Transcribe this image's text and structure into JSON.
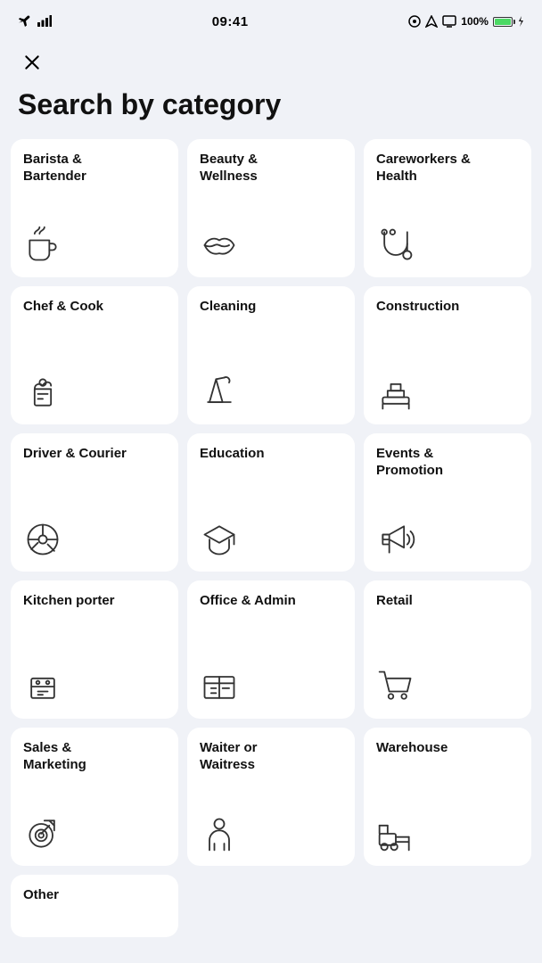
{
  "statusBar": {
    "time": "09:41",
    "battery": "100%",
    "signal": "●●●"
  },
  "closeLabel": "×",
  "pageTitle": "Search by category",
  "categories": [
    {
      "id": "barista-bartender",
      "label": "Barista &\nBartender",
      "icon": "coffee"
    },
    {
      "id": "beauty-wellness",
      "label": "Beauty &\nWellness",
      "icon": "lips"
    },
    {
      "id": "careworkers-health",
      "label": "Careworkers &\nHealth",
      "icon": "stethoscope"
    },
    {
      "id": "chef-cook",
      "label": "Chef & Cook",
      "icon": "chef"
    },
    {
      "id": "cleaning",
      "label": "Cleaning",
      "icon": "cleaning"
    },
    {
      "id": "construction",
      "label": "Construction",
      "icon": "construction"
    },
    {
      "id": "driver-courier",
      "label": "Driver & Courier",
      "icon": "steering"
    },
    {
      "id": "education",
      "label": "Education",
      "icon": "education"
    },
    {
      "id": "events-promotion",
      "label": "Events &\nPromotion",
      "icon": "megaphone"
    },
    {
      "id": "kitchen-porter",
      "label": "Kitchen porter",
      "icon": "kitchen"
    },
    {
      "id": "office-admin",
      "label": "Office & Admin",
      "icon": "office"
    },
    {
      "id": "retail",
      "label": "Retail",
      "icon": "cart"
    },
    {
      "id": "sales-marketing",
      "label": "Sales &\nMarketing",
      "icon": "target"
    },
    {
      "id": "waiter-waitress",
      "label": "Waiter or\nWaitress",
      "icon": "waiter"
    },
    {
      "id": "warehouse",
      "label": "Warehouse",
      "icon": "forklift"
    },
    {
      "id": "other",
      "label": "Other",
      "icon": "other"
    }
  ]
}
